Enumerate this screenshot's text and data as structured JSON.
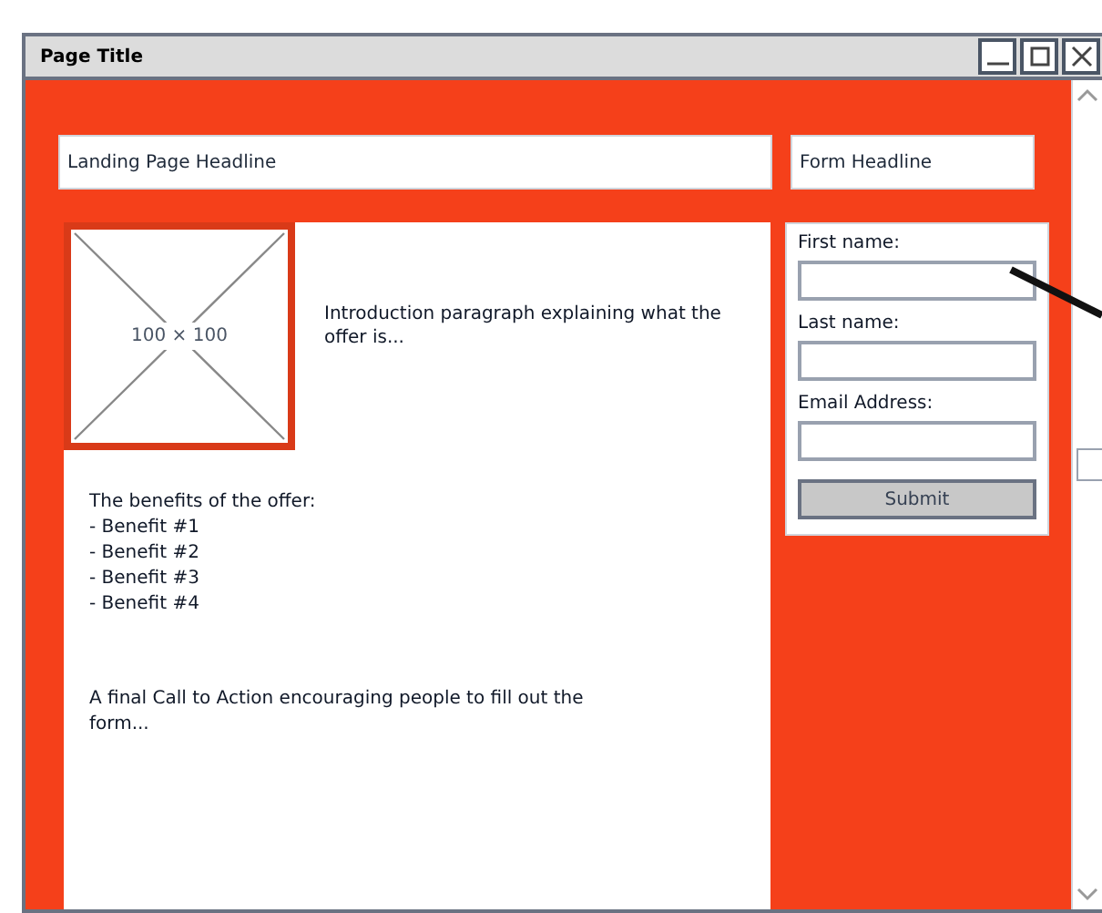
{
  "window": {
    "title": "Page Title"
  },
  "headline": "Landing Page Headline",
  "form_headline": "Form Headline",
  "image_placeholder": {
    "label": "100 × 100"
  },
  "intro": "Introduction paragraph explaining what the offer is...",
  "benefits": [
    "The benefits of the offer:",
    "- Benefit #1",
    "- Benefit #2",
    "- Benefit #3",
    "- Benefit #4"
  ],
  "call_to_action": "A final Call to Action encouraging people to fill out the form...",
  "form": {
    "fields": [
      {
        "label": "First name:"
      },
      {
        "label": "Last name:"
      },
      {
        "label": "Email Address:"
      }
    ],
    "submit": "Submit"
  }
}
